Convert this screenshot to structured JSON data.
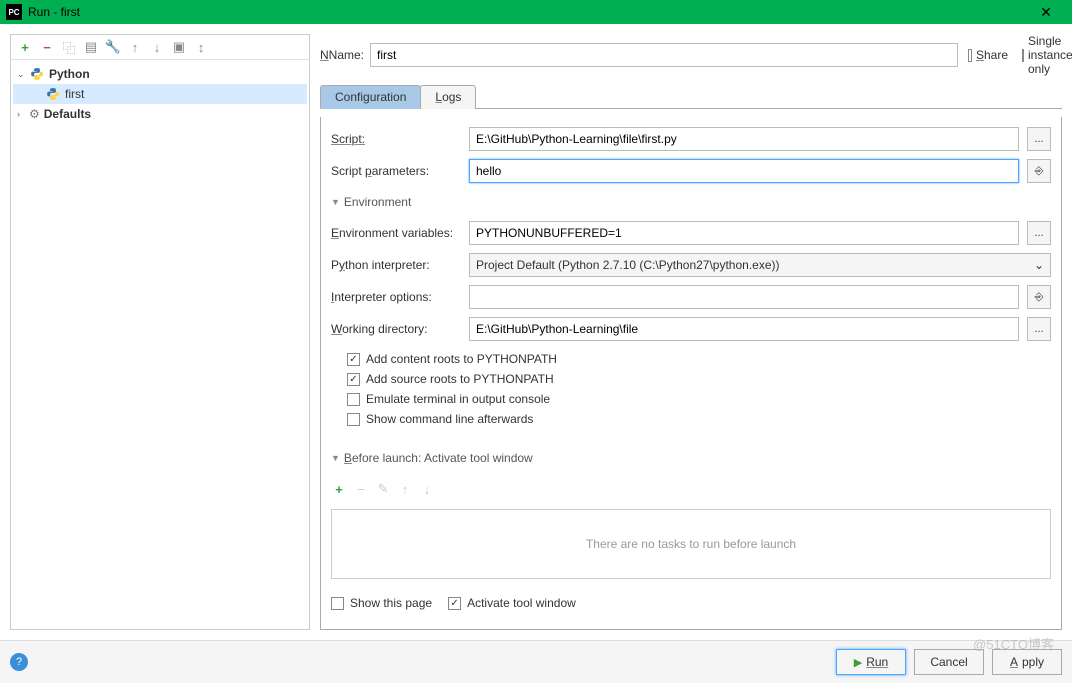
{
  "titlebar": {
    "icon_text": "PC",
    "title": "Run - first",
    "close_glyph": "✕"
  },
  "toolbar": {
    "plus": "+",
    "minus": "−",
    "copy": "⿻",
    "save": "▤",
    "wrench": "🔧",
    "up": "↑",
    "down": "↓",
    "folder": "▣",
    "sort": "↕"
  },
  "tree": {
    "items": [
      {
        "label": "Python",
        "bold": true,
        "icon": "python",
        "expanded": true
      },
      {
        "label": "first",
        "icon": "python",
        "selected": true,
        "child": true
      },
      {
        "label": "Defaults",
        "bold": true,
        "icon": "wrench",
        "expanded": false
      }
    ]
  },
  "header": {
    "name_label": "Name:",
    "name_value": "first",
    "share_label": "Share",
    "single_instance_label": "Single instance only"
  },
  "tabs": {
    "items": [
      {
        "label": "Configuration",
        "active": true
      },
      {
        "label": "Logs",
        "active": false
      }
    ]
  },
  "config": {
    "script_label": "Script:",
    "script_value": "E:\\GitHub\\Python-Learning\\file\\first.py",
    "params_label": "Script parameters:",
    "params_value": "hello",
    "env_section": "Environment",
    "env_vars_label": "Environment variables:",
    "env_vars_value": "PYTHONUNBUFFERED=1",
    "interpreter_label": "Python interpreter:",
    "interpreter_value": "Project Default (Python 2.7.10 (C:\\Python27\\python.exe))",
    "interp_options_label": "Interpreter options:",
    "interp_options_value": "",
    "workdir_label": "Working directory:",
    "workdir_value": "E:\\GitHub\\Python-Learning\\file",
    "browse_glyph": "...",
    "insert_glyph": "⎆",
    "dropdown_glyph": "⌄",
    "checkboxes": {
      "content_roots": {
        "label": "Add content roots to PYTHONPATH",
        "checked": true
      },
      "source_roots": {
        "label": "Add source roots to PYTHONPATH",
        "checked": true
      },
      "emulate_terminal": {
        "label": "Emulate terminal in output console",
        "checked": false
      },
      "show_cmdline": {
        "label": "Show command line afterwards",
        "checked": false
      }
    }
  },
  "before_launch": {
    "section_label": "Before launch: Activate tool window",
    "plus": "+",
    "minus": "−",
    "edit": "✎",
    "up": "↑",
    "down": "↓",
    "empty_text": "There are no tasks to run before launch",
    "show_page_label": "Show this page",
    "activate_window_label": "Activate tool window"
  },
  "footer": {
    "help": "?",
    "run": "Run",
    "cancel": "Cancel",
    "apply": "Apply"
  },
  "watermark": "@51CTO博客"
}
